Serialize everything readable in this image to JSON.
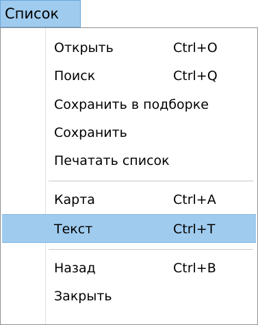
{
  "menubar": {
    "title": "Список"
  },
  "menu": {
    "open": {
      "label": "Открыть",
      "shortcut": "Ctrl+O"
    },
    "search": {
      "label": "Поиск",
      "shortcut": "Ctrl+Q"
    },
    "save_in_collection": {
      "label": "Сохранить в подборке"
    },
    "save": {
      "label": "Сохранить"
    },
    "print_list": {
      "label": "Печатать список"
    },
    "map": {
      "label": "Карта",
      "shortcut": "Ctrl+A"
    },
    "text": {
      "label": "Текст",
      "shortcut": "Ctrl+T"
    },
    "back": {
      "label": "Назад",
      "shortcut": "Ctrl+B"
    },
    "close": {
      "label": "Закрыть"
    }
  },
  "colors": {
    "highlight": "#9fcbee",
    "border": "#8e8e8e"
  }
}
